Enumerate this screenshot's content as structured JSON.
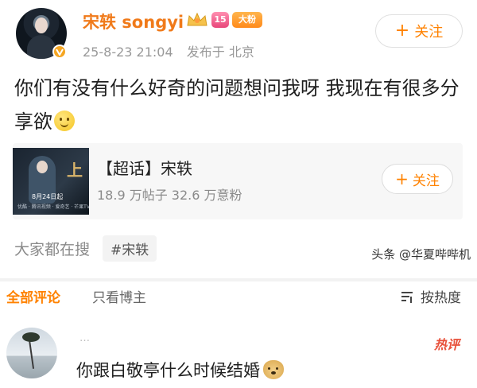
{
  "post": {
    "username": "宋轶 songyi",
    "level_badge": "15",
    "fans_badge": "大粉",
    "time": "25-8-23 21:04",
    "location": "发布于 北京",
    "follow_button": "关注",
    "follow_plus": "+",
    "content": "你们有没有什么好奇的问题想问我呀 我现在有很多分享欲"
  },
  "topic": {
    "thumb_text": "上",
    "thumb_date": "8月24日起",
    "thumb_bar": "优酷 · 腾讯视频 · 爱奇艺 · 芒果TV",
    "title": "【超话】宋轶",
    "stats": "18.9 万帖子  32.6 万意粉",
    "follow_button": "关注",
    "follow_plus": "+"
  },
  "search": {
    "label": "大家都在搜",
    "tag": "#宋轶"
  },
  "watermark": "头条 @华夏哔哔机",
  "comments": {
    "tab_all": "全部评论",
    "tab_author": "只看博主",
    "sort_label": "按热度"
  },
  "comment": {
    "name": "…",
    "hot_badge": "热评",
    "text": "你跟白敬亭什么时候结婚"
  },
  "colors": {
    "accent": "#ff8200",
    "username": "#f07a1a",
    "hot": "#e8503a"
  }
}
